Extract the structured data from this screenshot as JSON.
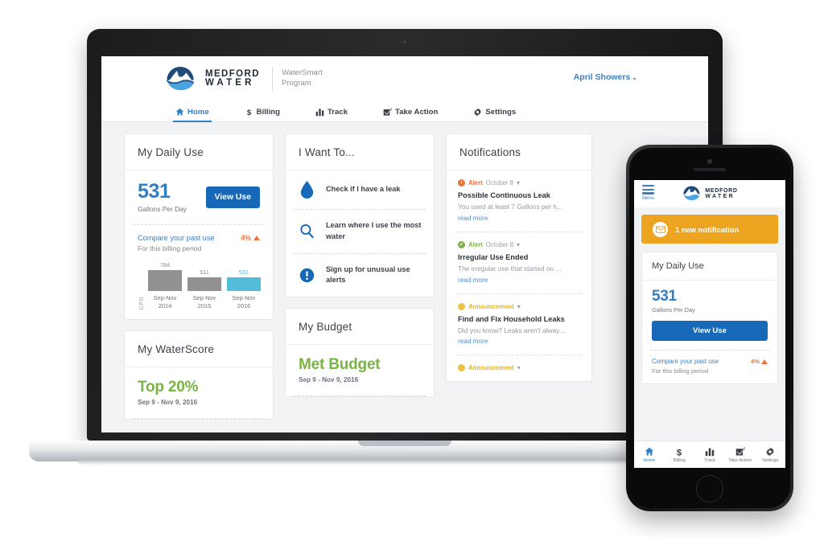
{
  "brand": {
    "name_line1": "MEDFORD",
    "name_line2": "WATER",
    "program_line1": "WaterSmart",
    "program_line2": "Program",
    "logo_icon": "mountain-water-logo"
  },
  "header": {
    "account_name": "April Showers",
    "account_caret": "⌄"
  },
  "nav": {
    "items": [
      {
        "label": "Home",
        "icon": "home-icon",
        "active": true
      },
      {
        "label": "Billing",
        "icon": "dollar-icon",
        "active": false
      },
      {
        "label": "Track",
        "icon": "bar-chart-icon",
        "active": false
      },
      {
        "label": "Take Action",
        "icon": "checkbox-check-icon",
        "active": false
      },
      {
        "label": "Settings",
        "icon": "gear-icon",
        "active": false
      }
    ]
  },
  "daily_use": {
    "title": "My Daily Use",
    "value": "531",
    "unit": "Gallons Per Day",
    "button_label": "View Use",
    "compare_link": "Compare your past use",
    "compare_pct": "4%",
    "compare_trend": "up",
    "compare_sub": "For this billing period"
  },
  "chart_data": {
    "type": "bar",
    "title": "Compare your past use",
    "subtitle": "For this billing period",
    "ylabel": "GPD",
    "xlabel": "",
    "categories": [
      "Sep-Nov 2014",
      "Sep-Nov 2015",
      "Sep-Nov 2016"
    ],
    "category_lines": [
      [
        "Sep-Nov",
        "2014"
      ],
      [
        "Sep-Nov",
        "2015"
      ],
      [
        "Sep-Nov",
        "2016"
      ]
    ],
    "values": [
      784,
      511,
      531
    ],
    "value_labels": [
      "784",
      "511",
      "531"
    ],
    "colors": [
      "#919191",
      "#919191",
      "#53bcd8"
    ],
    "highlight_index": 2,
    "ylim": [
      0,
      784
    ],
    "grid": false,
    "legend": "none"
  },
  "waterscore": {
    "title": "My WaterScore",
    "value": "Top 20%",
    "date_range": "Sep 9 - Nov 9, 2016"
  },
  "budget": {
    "title": "My Budget",
    "value": "Met Budget",
    "date_range": "Sep 9 - Nov 9, 2016"
  },
  "i_want_to": {
    "title": "I Want To...",
    "rows": [
      {
        "label": "Check if I have a leak",
        "icon": "water-drop-icon"
      },
      {
        "label": "Learn where I use the most water",
        "icon": "magnifier-icon"
      },
      {
        "label": "Sign up for unusual use alerts",
        "icon": "exclamation-circle-icon"
      }
    ]
  },
  "notifications": {
    "title": "Notifications",
    "read_more_label": "read more",
    "items": [
      {
        "kind": "Alert",
        "kind_class": "alert",
        "icon": "alert-exclamation-icon",
        "date": "October 8",
        "caret": "▾",
        "title": "Possible Continuous Leak",
        "body": "You used at least 7 Gallons per h..."
      },
      {
        "kind": "Alert",
        "kind_class": "ok",
        "icon": "check-circle-icon",
        "date": "October 8",
        "caret": "▾",
        "title": "Irregular Use Ended",
        "body": "The irregular use that started on ..."
      },
      {
        "kind": "Announcement",
        "kind_class": "ann",
        "icon": "announcement-icon",
        "date": "",
        "caret": "▾",
        "title": "Find and Fix Household Leaks",
        "body": "Did you know? Leaks aren't alway..."
      },
      {
        "kind": "Announcement",
        "kind_class": "ann",
        "icon": "announcement-icon",
        "date": "",
        "caret": "▾",
        "title": "",
        "body": ""
      }
    ]
  },
  "phone": {
    "menu_label": "Menu",
    "menu_icon": "hamburger-menu-icon",
    "notification_banner": {
      "text": "1 new notification",
      "icon": "envelope-icon",
      "color": "#eda420"
    },
    "daily_use": {
      "title": "My Daily Use",
      "value": "531",
      "unit": "Gallons Per Day",
      "button_label": "View Use",
      "compare_link": "Compare your past use",
      "compare_pct": "4%",
      "compare_sub": "For this billing period"
    },
    "tabs": [
      {
        "label": "Home",
        "icon": "home-icon",
        "active": true
      },
      {
        "label": "Billing",
        "icon": "dollar-icon",
        "active": false
      },
      {
        "label": "Track",
        "icon": "bar-chart-icon",
        "active": false
      },
      {
        "label": "Take Action",
        "icon": "checkbox-check-icon",
        "active": false
      },
      {
        "label": "Settings",
        "icon": "gear-icon",
        "active": false
      }
    ]
  },
  "colors": {
    "brand_blue": "#2f7fc4",
    "button_blue": "#1769b8",
    "green": "#79b443",
    "orange": "#e8743b",
    "amber": "#eda420",
    "teal": "#53bcd8",
    "gray_bar": "#919191"
  }
}
